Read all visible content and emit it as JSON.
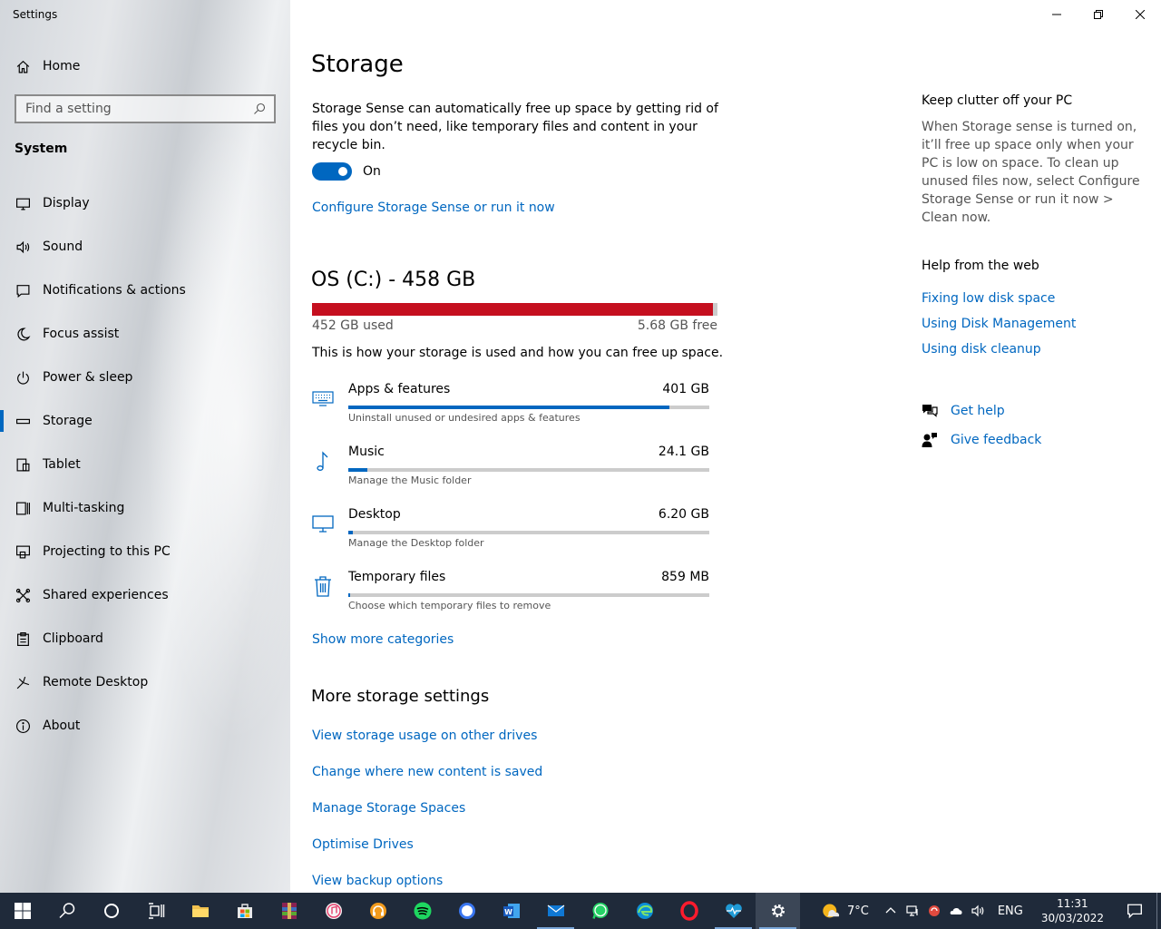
{
  "window": {
    "app_title": "Settings"
  },
  "sidebar": {
    "home_label": "Home",
    "search_placeholder": "Find a setting",
    "section": "System",
    "items": [
      {
        "label": "Display",
        "icon": "monitor-icon"
      },
      {
        "label": "Sound",
        "icon": "speaker-icon"
      },
      {
        "label": "Notifications & actions",
        "icon": "message-icon"
      },
      {
        "label": "Focus assist",
        "icon": "moon-icon"
      },
      {
        "label": "Power & sleep",
        "icon": "power-icon"
      },
      {
        "label": "Storage",
        "icon": "drive-icon",
        "selected": true
      },
      {
        "label": "Tablet",
        "icon": "tablet-icon"
      },
      {
        "label": "Multi-tasking",
        "icon": "multitask-icon"
      },
      {
        "label": "Projecting to this PC",
        "icon": "projector-icon"
      },
      {
        "label": "Shared experiences",
        "icon": "share-icon"
      },
      {
        "label": "Clipboard",
        "icon": "clipboard-icon"
      },
      {
        "label": "Remote Desktop",
        "icon": "remote-icon"
      },
      {
        "label": "About",
        "icon": "info-icon"
      }
    ]
  },
  "main": {
    "title": "Storage",
    "description": "Storage Sense can automatically free up space by getting rid of files you don’t need, like temporary files and content in your recycle bin.",
    "toggle_label": "On",
    "configure_link": "Configure Storage Sense or run it now",
    "drive": {
      "title": "OS (C:) - 458 GB",
      "used_label": "452 GB used",
      "free_label": "5.68 GB free",
      "used_fraction": 0.988
    },
    "intro": "This is how your storage is used and how you can free up space.",
    "categories": [
      {
        "name": "Apps & features",
        "size": "401 GB",
        "desc": "Uninstall unused or undesired apps & features",
        "fraction": 0.89,
        "icon": "keyboard-icon"
      },
      {
        "name": "Music",
        "size": "24.1 GB",
        "desc": "Manage the Music folder",
        "fraction": 0.053,
        "icon": "music-note-icon"
      },
      {
        "name": "Desktop",
        "size": "6.20 GB",
        "desc": "Manage the Desktop folder",
        "fraction": 0.013,
        "icon": "desktop-icon"
      },
      {
        "name": "Temporary files",
        "size": "859 MB",
        "desc": "Choose which temporary files to remove",
        "fraction": 0.003,
        "icon": "trash-icon"
      }
    ],
    "show_more": "Show more categories",
    "more_settings_title": "More storage settings",
    "more_links": [
      "View storage usage on other drives",
      "Change where new content is saved",
      "Manage Storage Spaces",
      "Optimise Drives",
      "View backup options"
    ]
  },
  "right_panel": {
    "clutter_title": "Keep clutter off your PC",
    "clutter_text": "When Storage sense is turned on, it’ll free up space only when your PC is low on space. To clean up unused files now, select Configure Storage Sense or run it now > Clean now.",
    "help_title": "Help from the web",
    "help_links": [
      "Fixing low disk space",
      "Using Disk Management",
      "Using disk cleanup"
    ],
    "get_help": "Get help",
    "give_feedback": "Give feedback"
  },
  "taskbar": {
    "temperature": "7°C",
    "language": "ENG",
    "time": "11:31",
    "date": "30/03/2022"
  }
}
